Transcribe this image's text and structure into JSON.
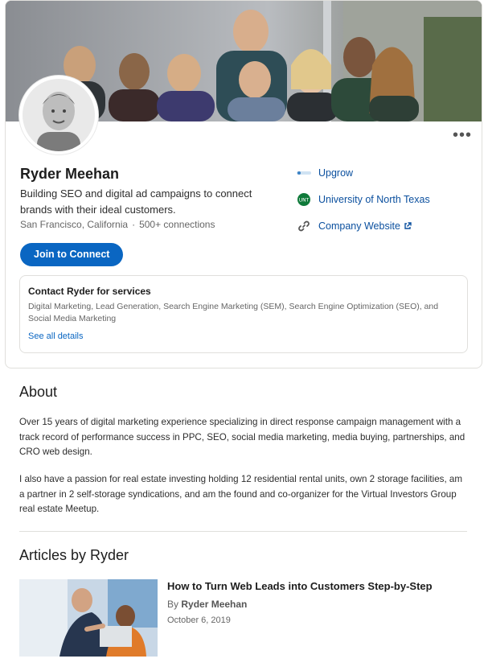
{
  "profile": {
    "name": "Ryder Meehan",
    "headline": "Building SEO and digital ad campaigns to connect brands with their ideal customers.",
    "location": "San Francisco, California",
    "separator": "·",
    "connections": "500+ connections",
    "join_label": "Join to Connect",
    "more_label": "•••"
  },
  "links": [
    {
      "icon": "upgrow-logo-icon",
      "label": "Upgrow"
    },
    {
      "icon": "unt-logo-icon",
      "label": "University of North Texas"
    },
    {
      "icon": "chain-link-icon",
      "label": "Company Website",
      "external": true
    }
  ],
  "services": {
    "title": "Contact Ryder for services",
    "list": "Digital Marketing, Lead Generation, Search Engine Marketing (SEM), Search Engine Optimization (SEO), and Social Media Marketing",
    "link": "See all details"
  },
  "about": {
    "heading": "About",
    "paragraph1": "Over 15 years of digital marketing experience specializing in direct response campaign management with a track record of performance success in PPC, SEO, social media marketing, media buying, partnerships, and CRO web design.",
    "paragraph2": "I also have a passion for real estate investing holding 12 residential rental units, own 2 storage facilities, am a partner in 2 self-storage syndications, and am the found and co-organizer for the Virtual Investors Group real estate Meetup."
  },
  "articles": {
    "heading": "Articles by Ryder",
    "items": [
      {
        "title": "How to Turn Web Leads into Customers Step-by-Step",
        "by_prefix": "By",
        "author": "Ryder Meehan",
        "date": "October 6, 2019"
      }
    ]
  },
  "colors": {
    "primary": "#0a66c2",
    "link": "#0a4f9e",
    "unt_green": "#0f7a3a"
  }
}
